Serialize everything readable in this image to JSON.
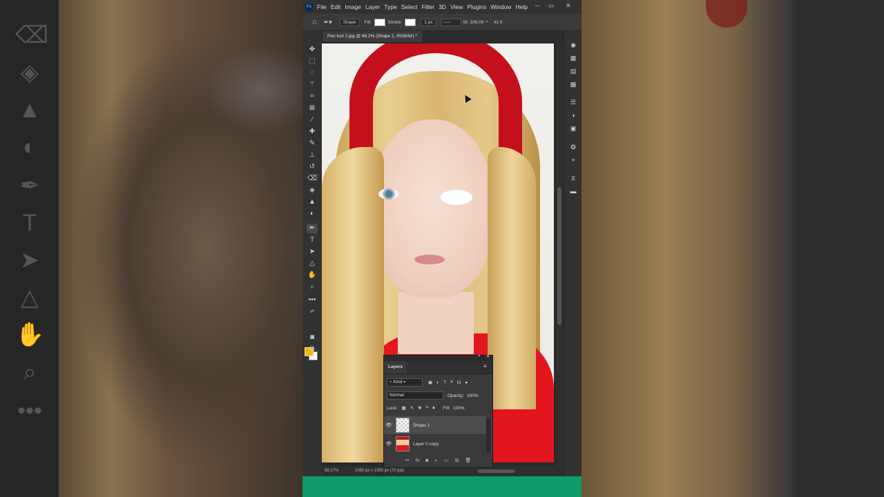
{
  "menu": [
    "File",
    "Edit",
    "Image",
    "Layer",
    "Type",
    "Select",
    "Filter",
    "3D",
    "View",
    "Plugins",
    "Window",
    "Help"
  ],
  "app_logo": "Ps",
  "window_controls": {
    "minimize": "─",
    "restore": "▭",
    "close": "✕"
  },
  "options_bar": {
    "tool_mode": "Shape",
    "fill_label": "Fill:",
    "stroke_label": "Stroke:",
    "stroke_width": "1 px",
    "w_label": "W:",
    "w_value": "106.09",
    "zoom_value": "42.9"
  },
  "document_tab": "Pen tool 2.jpg @ 68.2% (Shape 1, RGB/8#) *",
  "status": {
    "zoom": "68.17%",
    "dimensions": "1080 px x 1350 px (72 ppi)"
  },
  "layers_panel": {
    "title": "Layers",
    "kind_filter": "Kind",
    "blend_mode": "Normal",
    "opacity_label": "Opacity:",
    "opacity_value": "100%",
    "lock_label": "Lock:",
    "fill_label": "Fill:",
    "fill_value": "100%",
    "layers": [
      {
        "name": "Shape 1",
        "active": true
      },
      {
        "name": "Layer 0 copy",
        "active": false
      }
    ]
  },
  "colors": {
    "foreground": "#f5b800",
    "background": "#ffffff",
    "accent_bar": "#0e9a6b"
  },
  "icons": {
    "tools": [
      "move-icon",
      "marquee-icon",
      "lasso-icon",
      "magic-wand-icon",
      "crop-icon",
      "frame-icon",
      "eyedropper-icon",
      "healing-brush-icon",
      "brush-icon",
      "clone-stamp-icon",
      "history-brush-icon",
      "eraser-icon",
      "paint-bucket-icon",
      "blur-icon",
      "dodge-icon",
      "pen-icon",
      "type-icon",
      "path-selection-icon",
      "shape-icon",
      "hand-icon",
      "zoom-icon",
      "more-icon"
    ]
  }
}
